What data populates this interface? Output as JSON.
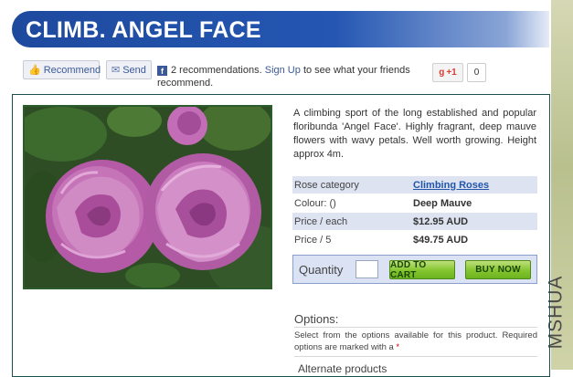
{
  "product": {
    "title": "CLIMB. ANGEL FACE",
    "description": "A climbing sport of the long established and popular floribunda 'Angel Face'. Highly fragrant, deep mauve flowers with wavy petals. Well worth growing. Height approx 4m."
  },
  "social": {
    "recommend_label": "Recommend",
    "send_label": "Send",
    "fb_text": "2 recommendations.",
    "signup_link": "Sign Up",
    "fb_text_after": "to see what your friends recommend.",
    "gplus_label": "+1",
    "gplus_count": "0"
  },
  "specs": [
    {
      "label": "Rose category",
      "value": "Climbing Roses"
    },
    {
      "label": "Colour: ()",
      "value": "Deep Mauve"
    },
    {
      "label": "Price / each",
      "value": "$12.95 AUD"
    },
    {
      "label": "Price / 5",
      "value": "$49.75 AUD"
    }
  ],
  "purchase": {
    "quantity_label": "Quantity",
    "quantity_value": "",
    "add_to_cart_label": "ADD TO CART",
    "buy_now_label": "BUY NOW"
  },
  "options": {
    "title": "Options:",
    "text": "Select from the options available for this product. Required options are marked with a",
    "required_marker": "*"
  },
  "alternate": {
    "title": "Alternate products"
  },
  "watermark": "MSHUA",
  "colors": {
    "banner": "#1e4a9e",
    "shade_row": "#dde3f1",
    "buy_button": "#83c52e",
    "panel_border": "#1f5050"
  }
}
